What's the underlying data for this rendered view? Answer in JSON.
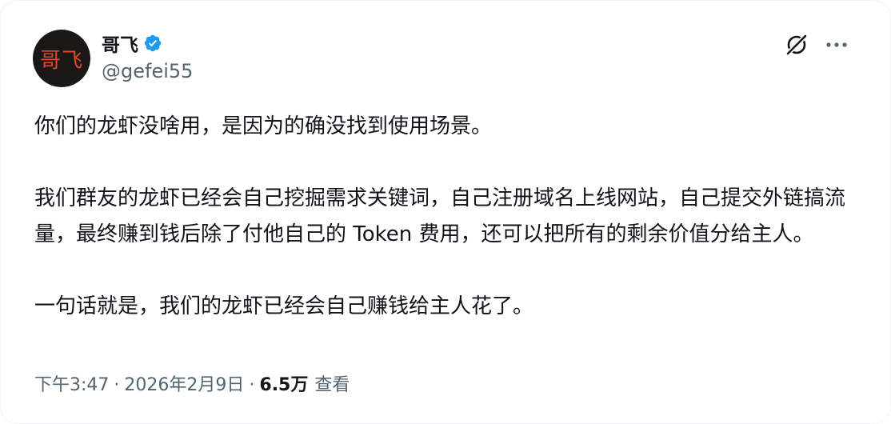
{
  "author": {
    "avatar_text": "哥飞",
    "display_name": "哥飞",
    "handle": "@gefei55",
    "verified": true,
    "verified_color": "#1d9bf0"
  },
  "icons": {
    "grok": "grok-icon",
    "more": "more-icon",
    "verified": "verified-icon"
  },
  "tweet": {
    "paragraphs": [
      "你们的龙虾没啥用，是因为的确没找到使用场景。",
      "我们群友的龙虾已经会自己挖掘需求关键词，自己注册域名上线网站，自己提交外链搞流量，最终赚到钱后除了付他自己的 Token 费用，还可以把所有的剩余价值分给主人。",
      "一句话就是，我们的龙虾已经会自己赚钱给主人花了。"
    ]
  },
  "meta": {
    "time": "下午3:47",
    "separator": "·",
    "date": "2026年2月9日",
    "views_count": "6.5万",
    "views_label": "查看"
  }
}
